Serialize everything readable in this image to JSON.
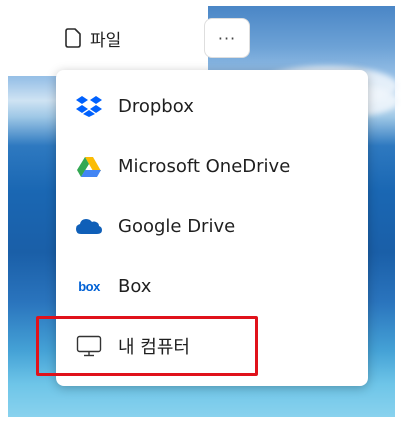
{
  "header": {
    "file_label": "파일",
    "more_label": "···"
  },
  "menu": {
    "items": [
      {
        "label": "Dropbox",
        "icon": "dropbox-icon"
      },
      {
        "label": "Microsoft OneDrive",
        "icon": "onedrive-icon"
      },
      {
        "label": "Google Drive",
        "icon": "google-drive-icon"
      },
      {
        "label": "Box",
        "icon": "box-icon",
        "icon_text": "box"
      },
      {
        "label": "내 컴퓨터",
        "icon": "computer-icon"
      }
    ]
  },
  "colors": {
    "highlight": "#e0121b",
    "dropbox": "#0061fe",
    "box": "#0061d5"
  }
}
